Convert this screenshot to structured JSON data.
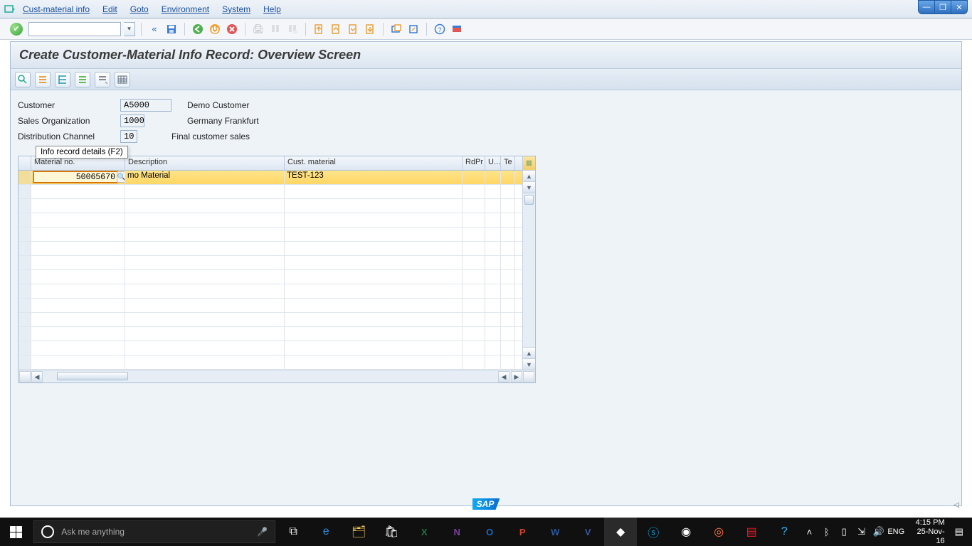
{
  "menu": {
    "items": [
      "Cust-material info",
      "Edit",
      "Goto",
      "Environment",
      "System",
      "Help"
    ]
  },
  "tooltip": {
    "text": "Info record details   (F2)"
  },
  "page": {
    "title": "Create Customer-Material Info Record: Overview Screen"
  },
  "header": {
    "rows": [
      {
        "label": "Customer",
        "value": "A5000",
        "desc": "Demo Customer"
      },
      {
        "label": "Sales Organization",
        "value": "1000",
        "desc": "Germany Frankfurt"
      },
      {
        "label": "Distribution Channel",
        "value": "10",
        "desc": "Final customer sales"
      }
    ]
  },
  "grid": {
    "columns": [
      "Material no.",
      "Description",
      "Cust. material",
      "RdPr",
      "U...",
      "Te"
    ],
    "rows": [
      {
        "material": "50065670",
        "description": "mo Material",
        "cust_material": "TEST-123",
        "rdpr": "",
        "u": "",
        "te": ""
      }
    ],
    "empty_row_count": 13
  },
  "taskbar": {
    "search_placeholder": "Ask me anything",
    "lang": "ENG",
    "time": "4:15 PM",
    "date": "25-Nov-16"
  }
}
